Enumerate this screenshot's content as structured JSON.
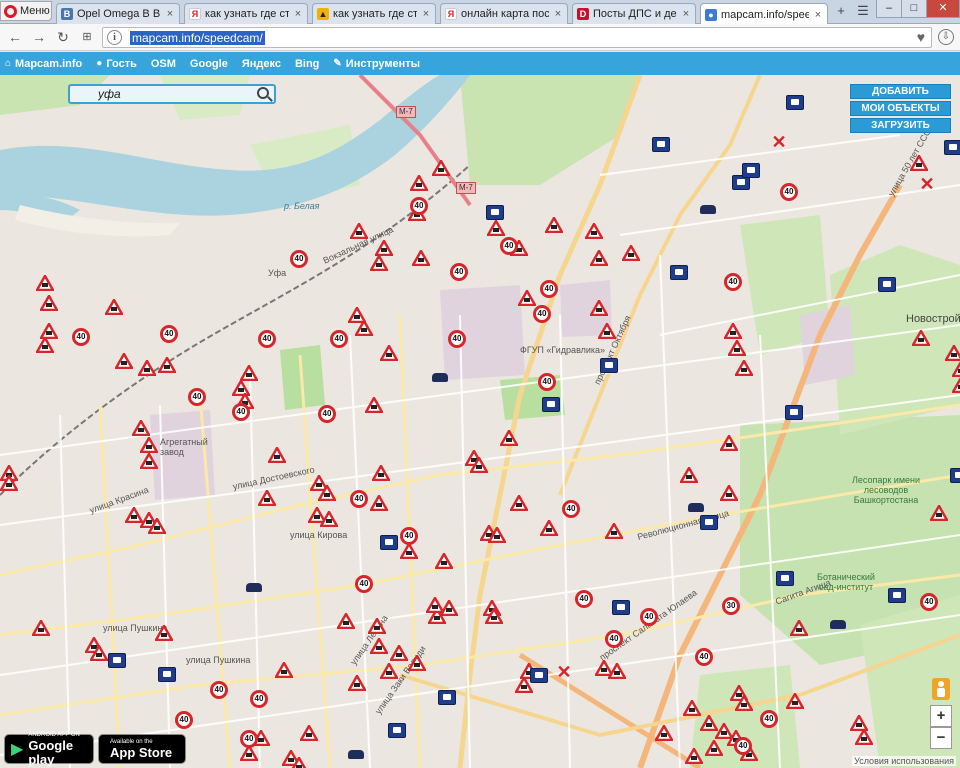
{
  "browser": {
    "menu_label": "Меню",
    "tabs": [
      {
        "title": "Opel Omega В ВК Клуб",
        "favicon_color": "#4a76a8",
        "favicon_glyph": "vk"
      },
      {
        "title": "как узнать где стоят г",
        "favicon_color": "#e02020",
        "favicon_glyph": "Я"
      },
      {
        "title": "как узнать где стоят г",
        "favicon_color": "#f0b400",
        "favicon_glyph": "▲"
      },
      {
        "title": "онлайн карта постов",
        "favicon_color": "#e02020",
        "favicon_glyph": "Я"
      },
      {
        "title": "Посты ДПС и действ",
        "favicon_color": "#c8102e",
        "favicon_glyph": "D"
      },
      {
        "title": "mapcam.info/speedca",
        "favicon_color": "#3a7bd5",
        "favicon_glyph": "●"
      }
    ],
    "tab_close_glyph": "×",
    "new_tab_glyph": "+",
    "url": "mapcam.info/speedcam/",
    "info_glyph": "i",
    "heart_glyph": "♥",
    "window_min": "–",
    "window_max": "□",
    "window_close": "✕"
  },
  "site_toolbar": {
    "items": [
      {
        "icon": "home-icon",
        "glyph": "⌂",
        "label": "Mapcam.info"
      },
      {
        "icon": "user-icon",
        "glyph": "●",
        "label": "Гость"
      },
      {
        "icon": "",
        "glyph": "",
        "label": "OSM"
      },
      {
        "icon": "",
        "glyph": "",
        "label": "Google"
      },
      {
        "icon": "",
        "glyph": "",
        "label": "Яндекс"
      },
      {
        "icon": "",
        "glyph": "",
        "label": "Bing"
      },
      {
        "icon": "wrench-icon",
        "glyph": "✎",
        "label": "Инструменты"
      }
    ]
  },
  "map": {
    "search_value": "уфа",
    "buttons": {
      "add": "ДОБАВИТЬ",
      "my_objects": "МОИ ОБЪЕКТЫ",
      "upload": "ЗАГРУЗИТЬ"
    },
    "zoom_in": "+",
    "zoom_out": "−",
    "terms": "Условия использования",
    "google_play": {
      "small": "ANDROID APP ON",
      "big": "Google play"
    },
    "app_store": {
      "small": "Available on the",
      "big": "App Store"
    },
    "labels": {
      "m7_a": "М-7",
      "m7_b": "М-7",
      "belaya": "р. Белая",
      "ufa": "Уфа",
      "vokzalnaya": "Вокзальная улица",
      "gidravlika": "ФГУП «Гидравлика»",
      "agregatny": "Агрегатный завод",
      "kirova": "улица Кирова",
      "pushkina1": "улица Пушкина",
      "pushkina2": "улица Пушкина",
      "oktyabrya": "проспект Октября",
      "dostoevskogo": "улица Достоевского",
      "krasina": "улица Красина",
      "revolyucionnaya": "Революционная улица",
      "salavata": "проспект Салавата Юлаева",
      "novostroy": "Новострой",
      "lesopark": "Лесопарк имени лесоводов Башкортостана",
      "botanic": "Ботанический сад-институт",
      "sykta": "Сагита Агиша",
      "ul50": "улица 50 лет СССР",
      "lenina": "улица Ленина",
      "zakiya": "улица Заки Валиди"
    },
    "speed_value": "40",
    "speed_value_alt": "30"
  }
}
